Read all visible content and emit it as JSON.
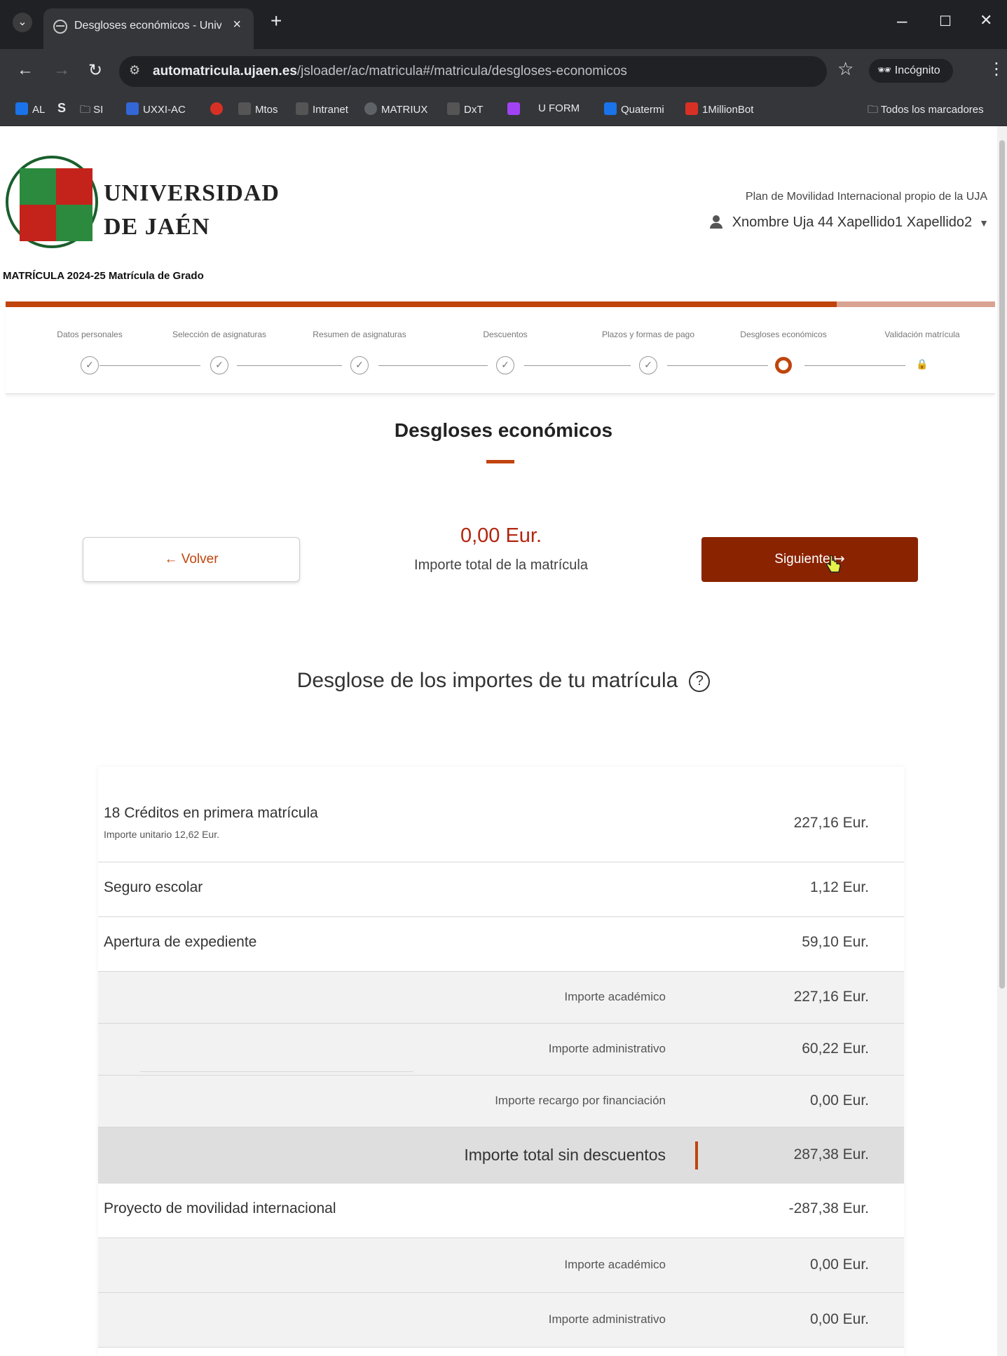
{
  "browser": {
    "tab_title": "Desgloses económicos - Unive",
    "tab_close": "×",
    "new_tab": "+",
    "url_host": "automatricula.ujaen.es",
    "url_path": "/jsloader/ac/matricula#/matricula/desgloses-economicos",
    "incognito_label": "Incógnito",
    "bookmarks": [
      {
        "label": "AL",
        "color": "#1a73e8"
      },
      {
        "label": "S",
        "color": "#e8eaed"
      },
      {
        "label": "SI",
        "color": "transparent"
      },
      {
        "label": "UXXI-AC",
        "color": "#3367d6"
      },
      {
        "label": "Mtos",
        "color": "#d93025"
      },
      {
        "label": "Intranet",
        "color": "#555"
      },
      {
        "label": "MATRIUX",
        "color": "#5f6368"
      },
      {
        "label": "DxT",
        "color": "#555"
      },
      {
        "label": "U FORM",
        "color": "#1a73e8"
      },
      {
        "label": "Quatermi",
        "color": "#1a73e8"
      },
      {
        "label": "1MillionBot",
        "color": "#d93025"
      }
    ],
    "all_bookmarks": "Todos los marcadores"
  },
  "header": {
    "logo_line1": "UNIVERSIDAD",
    "logo_line2": "DE JAÉN",
    "plan": "Plan de Movilidad Internacional propio de la UJA",
    "user_name": "Xnombre Uja 44 Xapellido1 Xapellido2",
    "matricula": "MATRÍCULA 2024-25 Matrícula de Grado",
    "progress_fraction": 0.84
  },
  "steps": [
    {
      "label": "Datos personales",
      "state": "done"
    },
    {
      "label": "Selección de asignaturas",
      "state": "done"
    },
    {
      "label": "Resumen de asignaturas",
      "state": "done"
    },
    {
      "label": "Descuentos",
      "state": "done"
    },
    {
      "label": "Plazos y formas de pago",
      "state": "done"
    },
    {
      "label": "Desgloses económicos",
      "state": "current"
    },
    {
      "label": "Validación matrícula",
      "state": "locked"
    }
  ],
  "main": {
    "title": "Desgloses económicos",
    "back_label": "← Volver",
    "next_label": "Siguiente ↦",
    "total_amount": "0,00 Eur.",
    "total_label": "Importe total de la matrícula",
    "section_title": "Desglose de los importes de tu matrícula",
    "help": "?"
  },
  "table": {
    "credits_label": "18 Créditos en primera matrícula",
    "credits_unit": "Importe unitario 12,62 Eur.",
    "credits_amount": "227,16 Eur.",
    "seguro_label": "Seguro escolar",
    "seguro_amount": "1,12 Eur.",
    "apertura_label": "Apertura de expediente",
    "apertura_amount": "59,10 Eur.",
    "academico_label": "Importe académico",
    "academico_amount": "227,16 Eur.",
    "administrativo_label": "Importe administrativo",
    "administrativo_amount": "60,22 Eur.",
    "recargo_label": "Importe recargo por financiación",
    "recargo_amount": "0,00 Eur.",
    "total_sin_label": "Importe total sin descuentos",
    "total_sin_amount": "287,38 Eur.",
    "movilidad_label": "Proyecto de movilidad internacional",
    "movilidad_amount": "-287,38 Eur.",
    "academico2_label": "Importe académico",
    "academico2_amount": "0,00 Eur.",
    "administrativo2_label": "Importe administrativo",
    "administrativo2_amount": "0,00 Eur."
  }
}
